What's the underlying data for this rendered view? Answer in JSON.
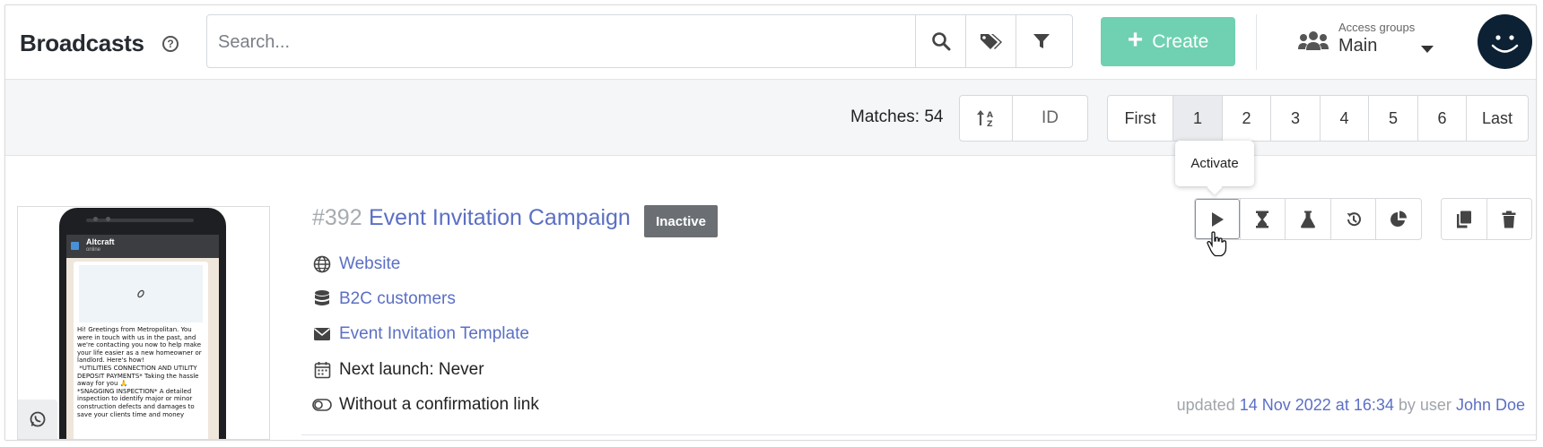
{
  "header": {
    "title": "Broadcasts",
    "help": "?",
    "search_placeholder": "Search...",
    "search_value": "",
    "create_label": "Create",
    "create_plus": "+",
    "access_groups_label": "Access groups",
    "access_groups_value": "Main",
    "colors": {
      "accent": "#6fd1b1",
      "avatar_bg": "#0c2133",
      "link": "#5b6fc4"
    }
  },
  "toolbar": {
    "matches": "Matches: 54",
    "sort_field": "ID",
    "pagination": [
      "First",
      "1",
      "2",
      "3",
      "4",
      "5",
      "6",
      "Last"
    ],
    "current_page": "1"
  },
  "tooltip": "Activate",
  "broadcast": {
    "id": "#392",
    "name": "Event Invitation Campaign",
    "status": "Inactive",
    "site": "Website",
    "database": "B2C customers",
    "template": "Event Invitation Template",
    "next_launch": "Next launch: Never",
    "confirmation": "Without a confirmation link",
    "updated_prefix": "updated",
    "updated_date": "14 Nov 2022 at 16:34",
    "updated_by": "by user",
    "user": "John Doe",
    "preview": {
      "app_name": "Altcraft",
      "app_status": "online",
      "message": "Hi! Greetings from Metropolitan. You were in touch with us in the past, and we're contacting you now to help make your life easier as a new homeowner or landlord. Here's how!\n *UTILITIES CONNECTION AND UTILITY DEPOSIT PAYMENTS* Taking the hassle away for you 🙏\n*SNAGGING INSPECTION* A detailed inspection to identify major or minor construction defects and damages to save your clients time and money"
    }
  },
  "icons": {
    "help": "question-circle-icon",
    "search": "search-icon",
    "tags": "tags-icon",
    "filter": "filter-icon",
    "access_groups": "users-icon",
    "avatar": "smiley-icon",
    "sort": "sort-alpha-icon",
    "actions": [
      "play-icon",
      "hourglass-icon",
      "flask-icon",
      "history-icon",
      "pie-chart-icon"
    ],
    "actions2": [
      "copy-icon",
      "trash-icon"
    ],
    "meta": [
      "globe-icon",
      "database-icon",
      "envelope-icon",
      "calendar-icon",
      "toggle-icon"
    ],
    "channel": "whatsapp-icon"
  }
}
